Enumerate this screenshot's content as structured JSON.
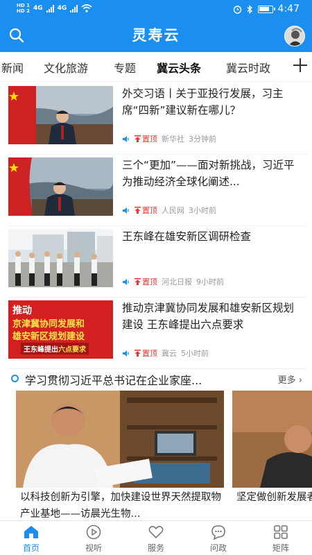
{
  "status": {
    "hd1": "HD 1",
    "hd2": "HD 2",
    "net1": "4G",
    "net2": "4G",
    "time": "4:47"
  },
  "header": {
    "title": "灵寿云"
  },
  "tabs": [
    {
      "label": "新闻"
    },
    {
      "label": "文化旅游"
    },
    {
      "label": "专题"
    },
    {
      "label": "冀云头条",
      "active": true
    },
    {
      "label": "冀云时政"
    }
  ],
  "news": [
    {
      "title": "外交习语丨关于亚投行发展，习主席“四新”建议新在哪儿？",
      "pin": "置顶",
      "source": "新华社",
      "time": "3分钟前"
    },
    {
      "title": "三个“更加”——面对新挑战，习近平为推动经济全球化阐述...",
      "pin": "置顶",
      "source": "人民网",
      "time": "3小时前"
    },
    {
      "title": "王东峰在雄安新区调研检查",
      "pin": "置顶",
      "source": "河北日报",
      "time": "9小时前"
    },
    {
      "title": "推动京津冀协同发展和雄安新区规划建设 王东峰提出六点要求",
      "pin": "置顶",
      "source": "冀云",
      "time": "5小时前"
    }
  ],
  "banner4": {
    "line1": "推动",
    "line2": "京津冀协同发展和",
    "line3": "雄安新区规划建设",
    "line4a": "王东峰提出",
    "line4b": "六点要求"
  },
  "section": {
    "title": "学习贯彻习近平总书记在企业家座...",
    "more": "更多"
  },
  "cards": [
    {
      "title": "以科技创新为引擎，加快建设世界天然提取物产业基地——访晨光生物..."
    },
    {
      "title": "坚定做创新发展者——访以岭"
    }
  ],
  "bottom_nav": [
    {
      "label": "首页",
      "icon": "home-icon",
      "active": true
    },
    {
      "label": "视听",
      "icon": "play-icon"
    },
    {
      "label": "服务",
      "icon": "heart-icon"
    },
    {
      "label": "问政",
      "icon": "chat-icon"
    },
    {
      "label": "矩阵",
      "icon": "grid-icon"
    }
  ],
  "colors": {
    "brand": "#1a8ff0",
    "pin": "#e53935"
  }
}
